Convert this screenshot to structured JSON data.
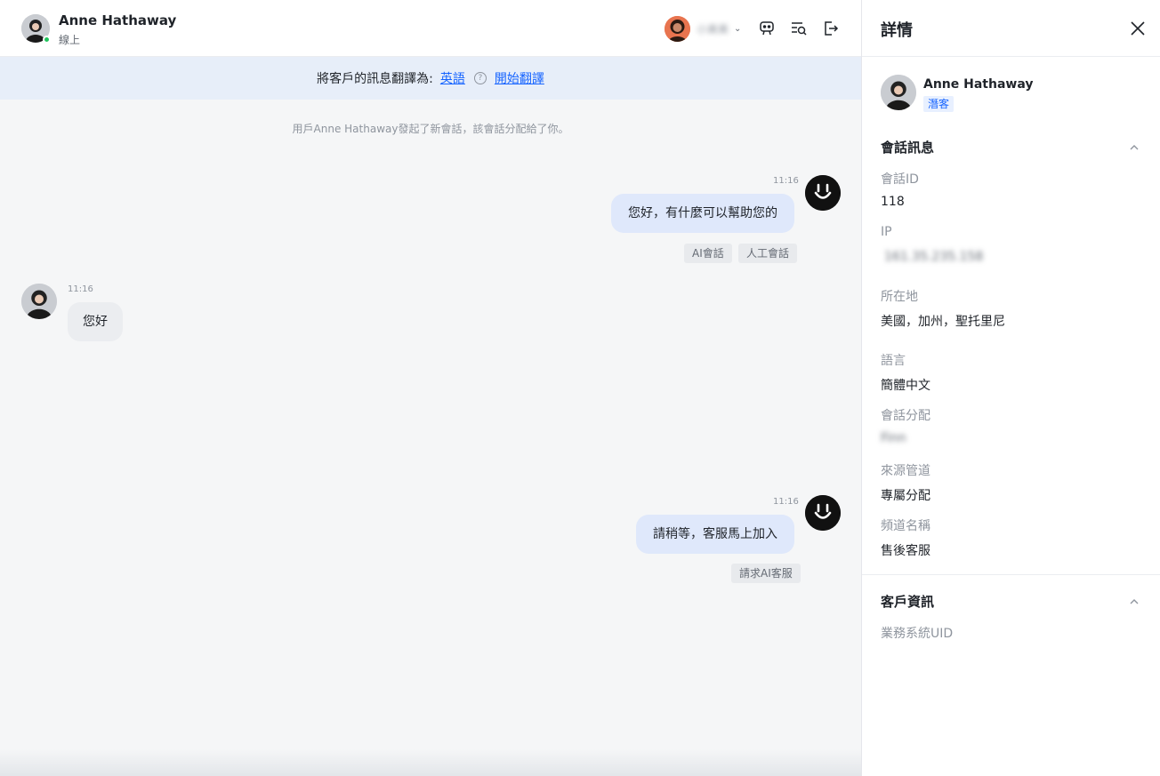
{
  "header": {
    "customer_name": "Anne Hathaway",
    "customer_status": "線上",
    "agent_name": "小美美",
    "caret": "⌄",
    "icons": [
      "robot-icon",
      "search-list-icon",
      "logout-icon"
    ]
  },
  "translate_bar": {
    "prefix": "將客戶的訊息翻譯為:",
    "language": "英語",
    "help": "?",
    "action": "開始翻譯"
  },
  "system_note": "用戶Anne Hathaway發起了新會話，該會話分配給了你。",
  "messages": [
    {
      "time": "11:16",
      "text": "您好，有什麼可以幫助您的",
      "tags": [
        "AI會話",
        "人工會話"
      ]
    },
    {
      "time": "11:16",
      "text": "您好"
    },
    {
      "time": "11:16",
      "text": "請稍等，客服馬上加入",
      "tags": [
        "請求AI客服"
      ]
    }
  ],
  "panel": {
    "title": "詳情",
    "customer_name": "Anne Hathaway",
    "customer_badge": "潛客",
    "session_section": {
      "title": "會話訊息",
      "fields": [
        {
          "label": "會話ID",
          "value": "118"
        },
        {
          "label": "IP",
          "value": "161.35.235.158"
        },
        {
          "label": "所在地",
          "value": "美國，加州，聖托里尼"
        },
        {
          "label": "語言",
          "value": "簡體中文"
        },
        {
          "label": "會話分配",
          "value": "Finn"
        },
        {
          "label": "來源管道",
          "value": "專屬分配"
        },
        {
          "label": "頻道名稱",
          "value": "售後客服"
        }
      ]
    },
    "customer_section": {
      "title": "客戶資訊",
      "fields": [
        {
          "label": "業務系統UID"
        }
      ]
    }
  },
  "colors": {
    "accent": "#1664ff",
    "outgoing_bubble": "#dfe8fb",
    "incoming_bubble": "#ebedf0",
    "translate_bar": "#e7eef9",
    "online": "#22c55e"
  }
}
